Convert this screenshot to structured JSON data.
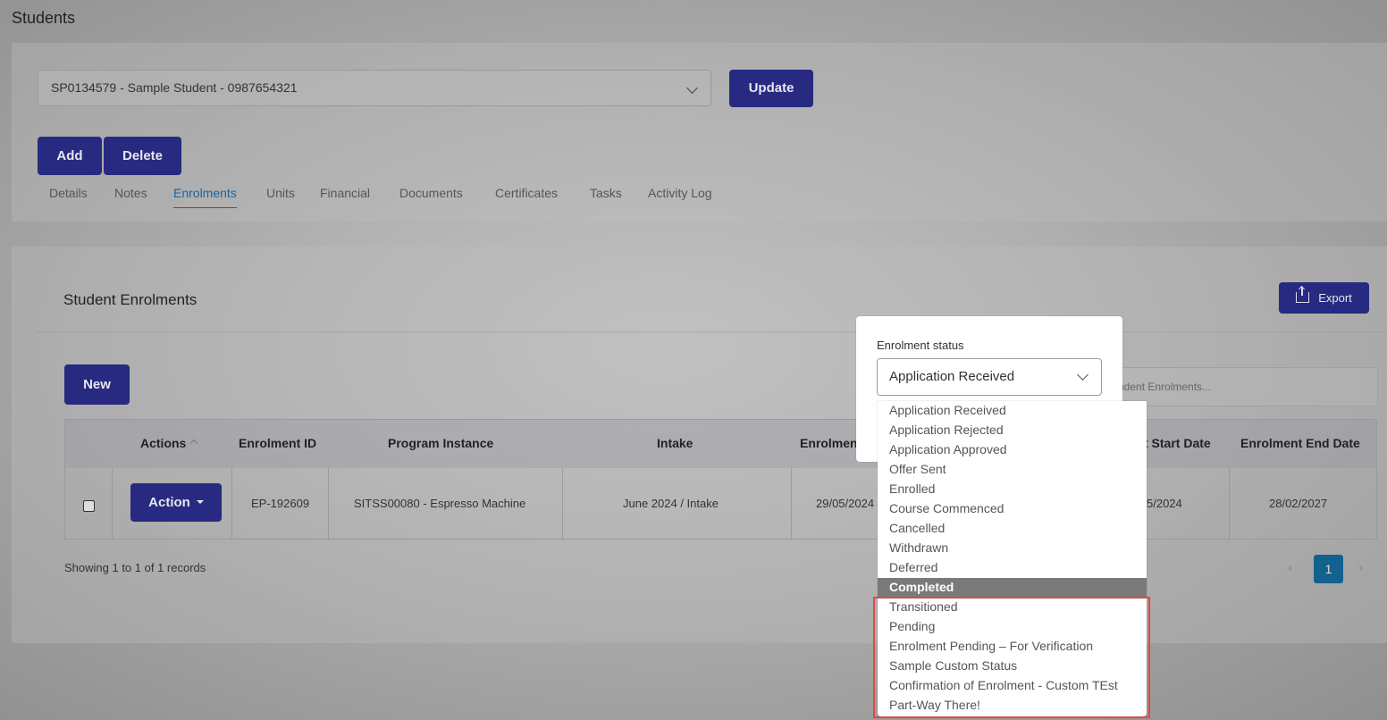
{
  "page": {
    "title": "Students"
  },
  "student_selector": {
    "value": "SP0134579 - Sample Student - 0987654321"
  },
  "buttons": {
    "update": "Update",
    "add": "Add",
    "delete": "Delete",
    "new": "New",
    "export": "Export",
    "action": "Action"
  },
  "tabs": [
    "Details",
    "Notes",
    "Enrolments",
    "Units",
    "Financial",
    "Documents",
    "Certificates",
    "Tasks",
    "Activity Log"
  ],
  "active_tab": "Enrolments",
  "enrolments": {
    "title": "Student Enrolments",
    "search_placeholder": "udent Enrolments...",
    "columns": [
      "Actions",
      "Enrolment ID",
      "Program Instance",
      "Intake",
      "Enrolmen",
      "t Start Date",
      "Enrolment End Date"
    ],
    "row": {
      "enrolment_id": "EP-192609",
      "program_instance": "SITSS00080 - Espresso Machine",
      "intake": "June 2024 / Intake",
      "enrolment_date": "29/05/2024",
      "start_date": "5/2024",
      "end_date": "28/02/2027"
    },
    "showing": "Showing 1 to 1 of 1 records",
    "pagination": {
      "prev": "‹",
      "current": "1",
      "next": "›"
    }
  },
  "status_modal": {
    "label": "Enrolment status",
    "selected_value": "Application Received",
    "options": [
      "Application Received",
      "Application Rejected",
      "Application Approved",
      "Offer Sent",
      "Enrolled",
      "Course Commenced",
      "Cancelled",
      "Withdrawn",
      "Deferred",
      "Completed",
      "Transitioned",
      "Pending",
      "Enrolment Pending – For Verification",
      "Sample Custom Status",
      "Confirmation of Enrolment - Custom TEst",
      "Part-Way There!"
    ],
    "highlighted_option": "Completed"
  },
  "colors": {
    "primary": "#272a80",
    "active_tab": "#1b63a0",
    "highlight_border": "#dc4c44",
    "pager_active": "#13628e"
  }
}
